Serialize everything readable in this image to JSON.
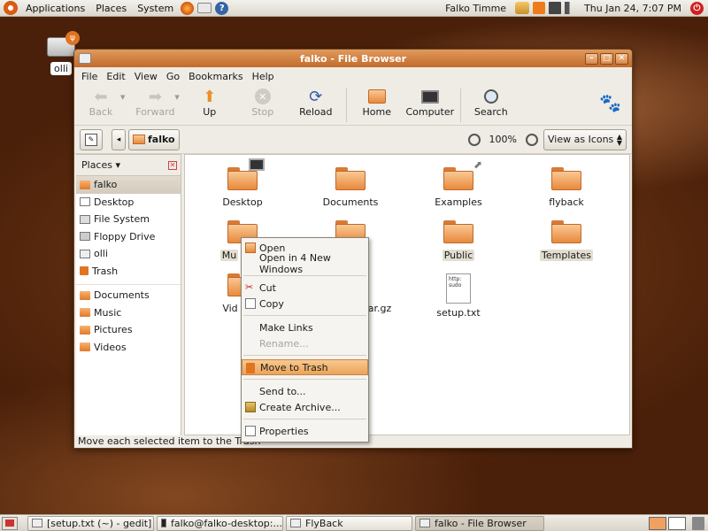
{
  "top_panel": {
    "menus": [
      "Applications",
      "Places",
      "System"
    ],
    "user": "Falko Timme",
    "clock": "Thu Jan 24,  7:07 PM"
  },
  "desktop": {
    "icon_label": "olli"
  },
  "window": {
    "title": "falko - File Browser",
    "menubar": [
      "File",
      "Edit",
      "View",
      "Go",
      "Bookmarks",
      "Help"
    ],
    "toolbar": {
      "back": "Back",
      "forward": "Forward",
      "up": "Up",
      "stop": "Stop",
      "reload": "Reload",
      "home": "Home",
      "computer": "Computer",
      "search": "Search"
    },
    "location": {
      "path_button": "falko",
      "zoom": "100%",
      "view_mode": "View as Icons"
    },
    "sidebar": {
      "header": "Places",
      "items": [
        "falko",
        "Desktop",
        "File System",
        "Floppy Drive",
        "olli",
        "Trash"
      ],
      "bookmarks": [
        "Documents",
        "Music",
        "Pictures",
        "Videos"
      ]
    },
    "files": {
      "desktop": "Desktop",
      "documents": "Documents",
      "examples": "Examples",
      "flyback": "flyback",
      "music_partial": "Mu",
      "public": "Public",
      "templates": "Templates",
      "videos_partial": "Vid",
      "archive_partial": "ar.gz",
      "setup": "setup.txt",
      "setup_preview": "http:\nsudo"
    },
    "statusbar": "Move each selected item to the Trash"
  },
  "context_menu": {
    "open": "Open",
    "open_windows": "Open in 4 New Windows",
    "cut": "Cut",
    "copy": "Copy",
    "make_links": "Make Links",
    "rename": "Rename...",
    "move_to_trash": "Move to Trash",
    "send_to": "Send to...",
    "create_archive": "Create Archive...",
    "properties": "Properties"
  },
  "taskbar": {
    "tasks": [
      "[setup.txt (~) - gedit]",
      "falko@falko-desktop:...",
      "FlyBack",
      "falko - File Browser"
    ]
  }
}
